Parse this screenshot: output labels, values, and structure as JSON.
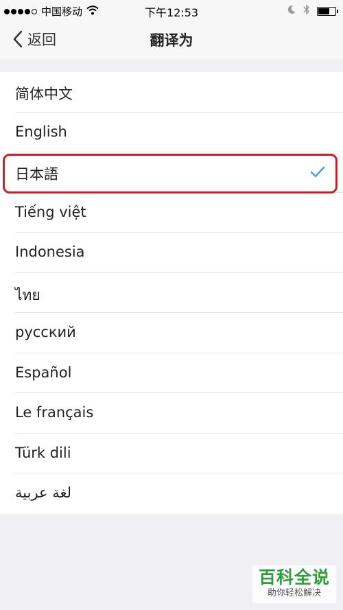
{
  "status_bar": {
    "carrier": "中国移动",
    "time": "下午12:53"
  },
  "nav": {
    "back_label": "返回",
    "title": "翻译为"
  },
  "languages": [
    {
      "label": "简体中文"
    },
    {
      "label": "English"
    },
    {
      "label": "日本語",
      "selected": true
    },
    {
      "label": "Tiếng việt"
    },
    {
      "label": "Indonesia"
    },
    {
      "label": "ไทย"
    },
    {
      "label": "русский"
    },
    {
      "label": "Español"
    },
    {
      "label": "Le français"
    },
    {
      "label": "Türk dili"
    },
    {
      "label": "لغة عربية"
    }
  ],
  "colors": {
    "check": "#4a9fd8",
    "highlight": "#c8202b",
    "watermark_green": "#2f9e3a"
  },
  "watermark": {
    "title": "百科全说",
    "subtitle": "助你轻松解决"
  }
}
